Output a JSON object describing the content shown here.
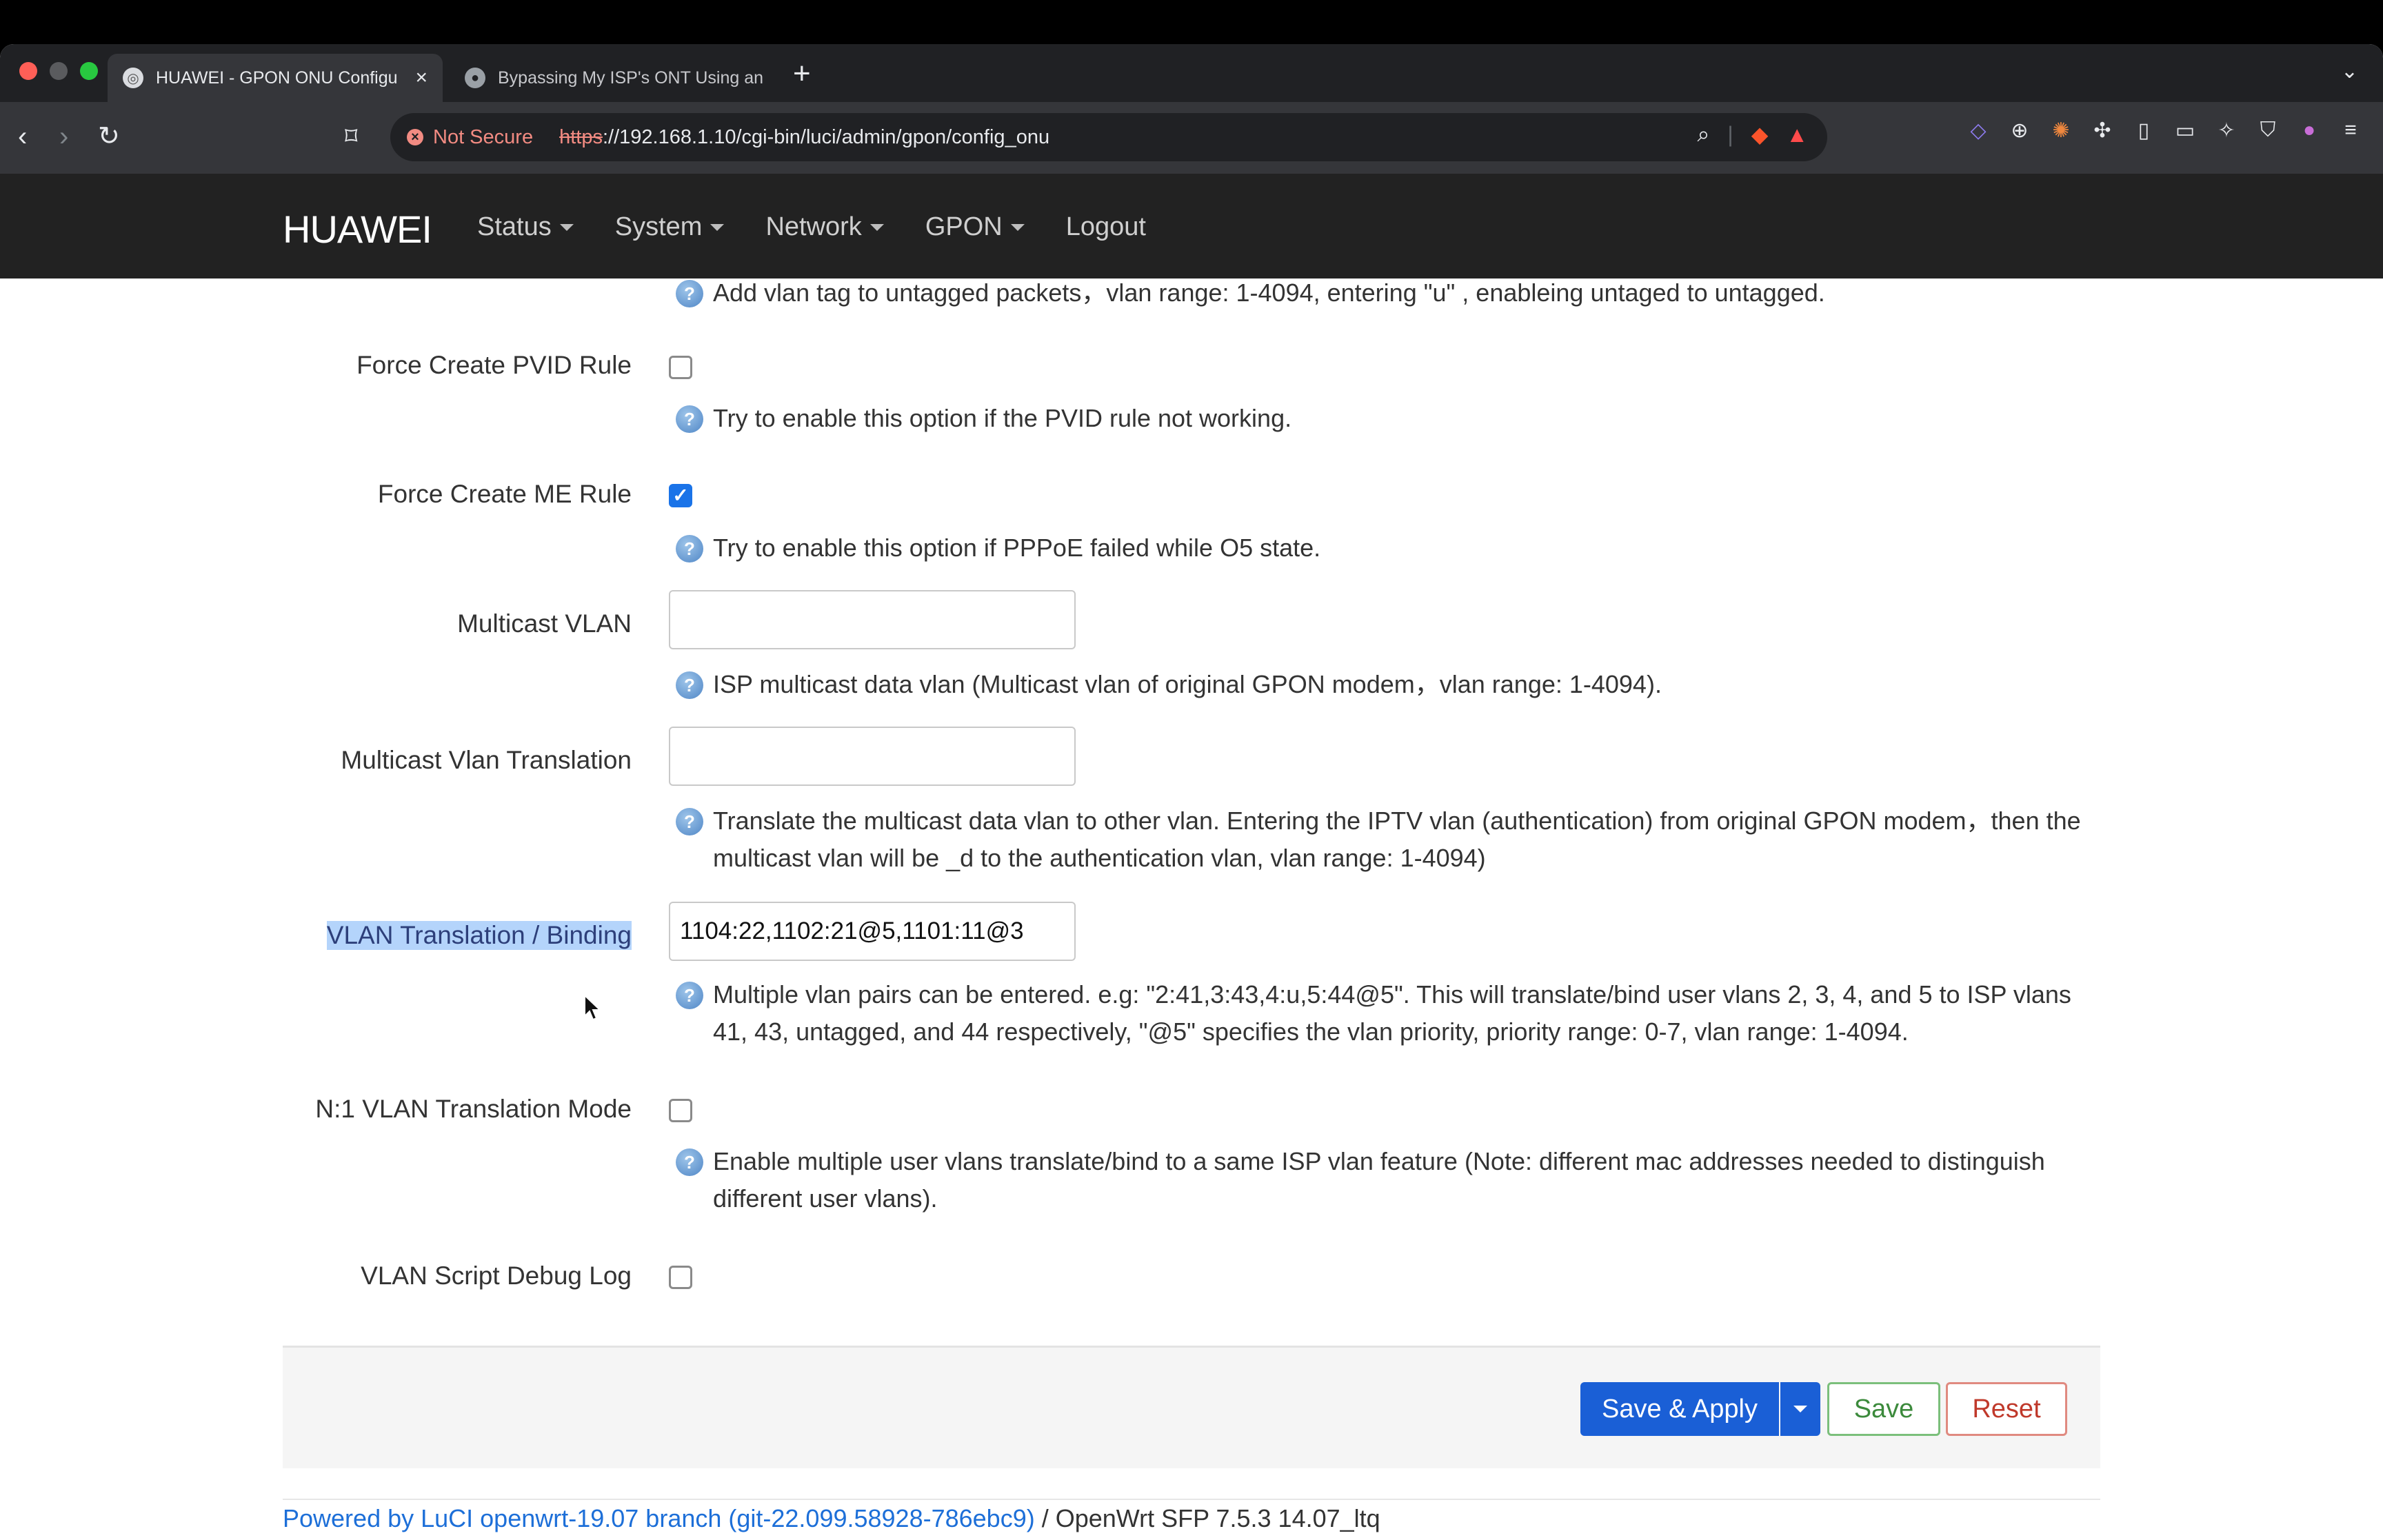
{
  "browser": {
    "tabs": [
      {
        "title": "HUAWEI - GPON ONU Configu",
        "active": true
      },
      {
        "title": "Bypassing My ISP's ONT Using an",
        "active": false
      }
    ],
    "new_tab_label": "+",
    "security_label": "Not Secure",
    "url_scheme": "https",
    "url_rest": "://192.168.1.10/cgi-bin/luci/admin/gpon/config_onu"
  },
  "nav": {
    "brand": "HUAWEI",
    "menu": [
      "Status",
      "System",
      "Network",
      "GPON",
      "Logout"
    ]
  },
  "form": {
    "top_help": "Add vlan tag to untagged packets，vlan range: 1-4094, entering \"u\" , enableing untaged to untagged.",
    "force_pvid": {
      "label": "Force Create PVID Rule",
      "checked": false,
      "help": "Try to enable this option if the PVID rule not working."
    },
    "force_me": {
      "label": "Force Create ME Rule",
      "checked": true,
      "help": "Try to enable this option if PPPoE failed while O5 state."
    },
    "multicast_vlan": {
      "label": "Multicast VLAN",
      "value": "",
      "help": "ISP multicast data vlan (Multicast vlan of original GPON modem，vlan range: 1-4094)."
    },
    "multicast_translation": {
      "label": "Multicast Vlan Translation",
      "value": "",
      "help_line1": "Translate the multicast data vlan to other vlan. Entering the IPTV vlan (authentication) from original GPON modem，then the",
      "help_line2": "multicast vlan will be _d to the authentication vlan, vlan range: 1-4094)"
    },
    "vlan_binding": {
      "label": "VLAN Translation / Binding",
      "value": "1104:22,1102:21@5,1101:11@3",
      "help_line1": "Multiple vlan pairs can be entered. e.g: \"2:41,3:43,4:u,5:44@5\". This will translate/bind user vlans 2, 3, 4, and 5 to ISP vlans",
      "help_line2": "41, 43, untagged, and 44 respectively, \"@5\" specifies the vlan priority, priority range: 0-7, vlan range: 1-4094."
    },
    "n1_mode": {
      "label": "N:1 VLAN Translation Mode",
      "checked": false,
      "help_line1": "Enable multiple user vlans translate/bind to a same ISP vlan feature (Note: different mac addresses needed to distinguish",
      "help_line2": "different user vlans)."
    },
    "debug_log": {
      "label": "VLAN Script Debug Log",
      "checked": false
    }
  },
  "actions": {
    "save_apply": "Save & Apply",
    "save": "Save",
    "reset": "Reset"
  },
  "footer": {
    "link": "Powered by LuCI openwrt-19.07 branch (git-22.099.58928-786ebc9)",
    "rest": " / OpenWrt SFP 7.5.3 14.07_ltq"
  },
  "colors": {
    "primary": "#1a5fd6",
    "save_green": "#3c8a3c",
    "reset_red": "#c0392b",
    "navbar": "#222222",
    "link": "#1d6fd8"
  }
}
